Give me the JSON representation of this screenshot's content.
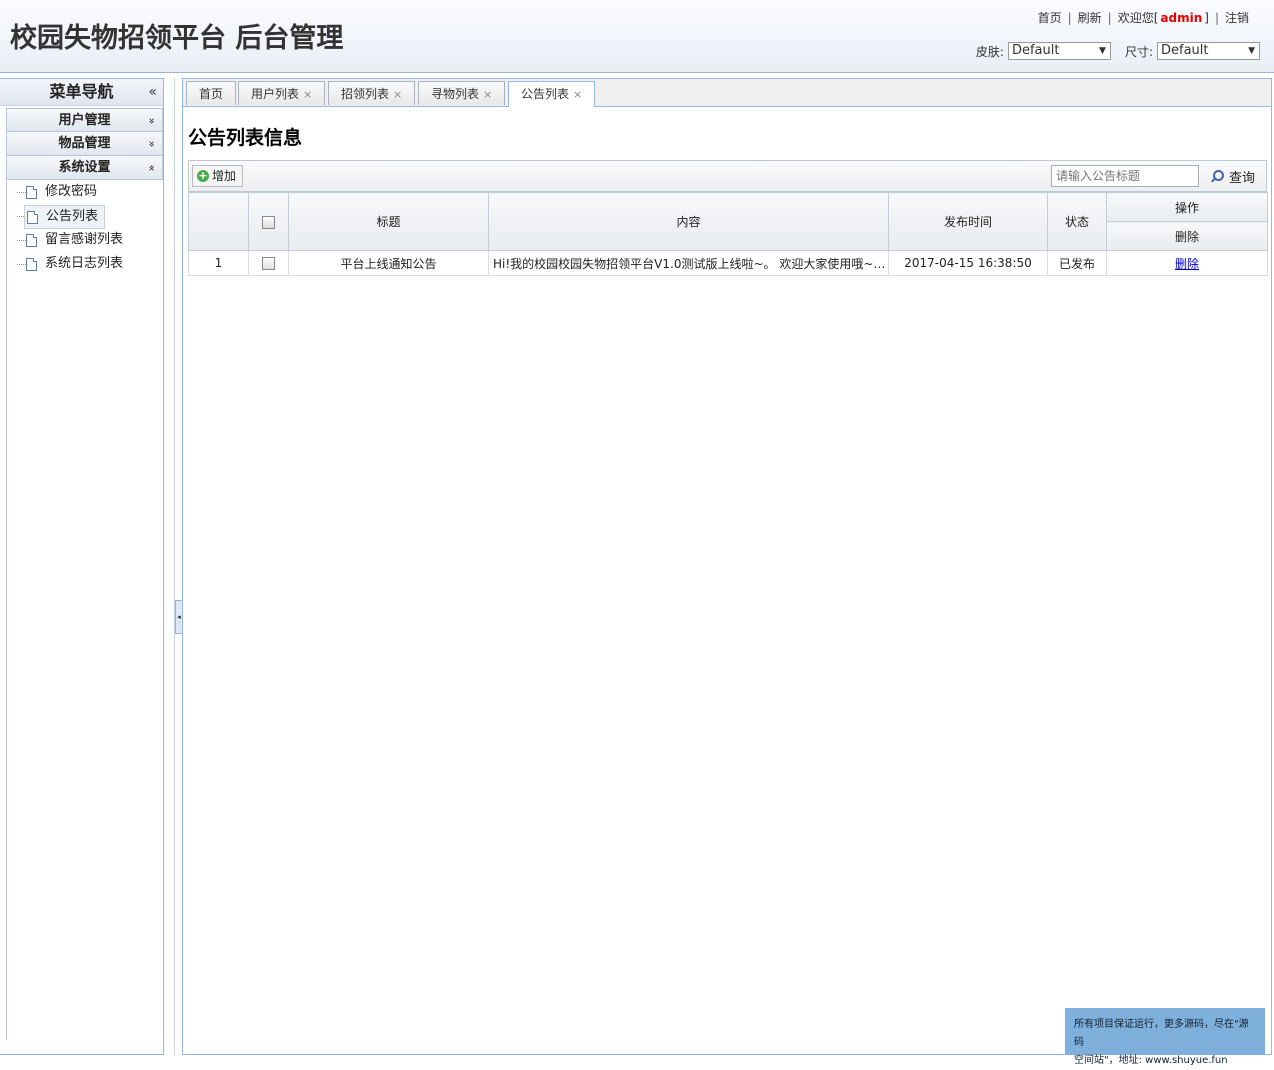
{
  "app": {
    "title": "校园失物招领平台 后台管理"
  },
  "top_links": {
    "home": "首页",
    "refresh": "刷新",
    "welcome_prefix": "欢迎您[",
    "user": "admin",
    "welcome_suffix": "]",
    "logout": "注销",
    "sep": "|"
  },
  "theme": {
    "skin_label": "皮肤:",
    "skin_value": "Default",
    "size_label": "尺寸:",
    "size_value": "Default"
  },
  "sidebar": {
    "title": "菜单导航",
    "collapse_glyph": "«",
    "groups": [
      {
        "label": "用户管理",
        "toggle": "»"
      },
      {
        "label": "物品管理",
        "toggle": "»"
      },
      {
        "label": "系统设置",
        "toggle": "«"
      }
    ],
    "items": [
      {
        "label": "修改密码"
      },
      {
        "label": "公告列表"
      },
      {
        "label": "留言感谢列表"
      },
      {
        "label": "系统日志列表"
      }
    ]
  },
  "tabs": [
    {
      "label": "首页"
    },
    {
      "label": "用户列表",
      "close": "×"
    },
    {
      "label": "招领列表",
      "close": "×"
    },
    {
      "label": "寻物列表",
      "close": "×"
    },
    {
      "label": "公告列表",
      "close": "×"
    }
  ],
  "main": {
    "page_title": "公告列表信息",
    "add_label": "增加",
    "search_placeholder": "请输入公告标题",
    "search_label": "查询"
  },
  "table": {
    "headers": {
      "title": "标题",
      "content": "内容",
      "time": "发布时间",
      "status": "状态",
      "ops": "操作",
      "ops_sub": "删除"
    },
    "rows": [
      {
        "index": "1",
        "title": "平台上线通知公告",
        "content": "Hi!我的校园校园失物招领平台V1.0测试版上线啦~。 欢迎大家使用哦~~...",
        "time": "2017-04-15 16:38:50",
        "status": "已发布",
        "action": "删除"
      }
    ]
  },
  "footer": {
    "line1": "所有项目保证运行，更多源码，尽在\"源码",
    "line2": "空间站\"，地址: www.shuyue.fun"
  }
}
